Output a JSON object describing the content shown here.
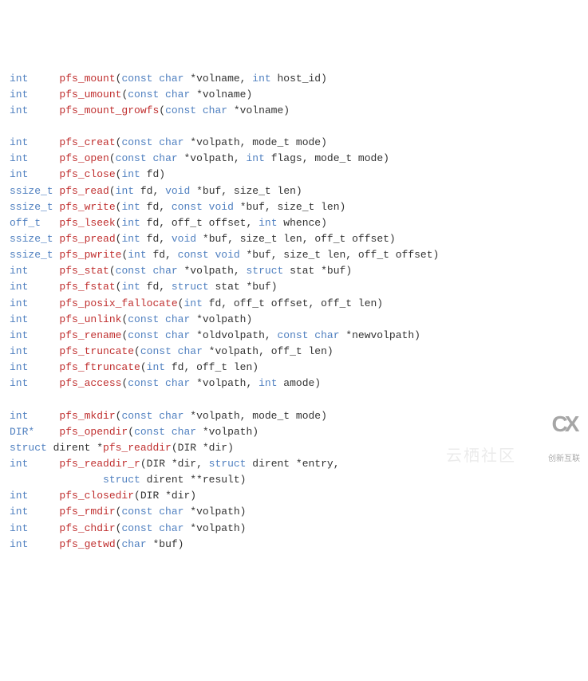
{
  "lines": [
    {
      "ret": "int    ",
      "fn": "pfs_mount",
      "params": [
        [
          "kw",
          "const char"
        ],
        [
          "p",
          " *volname, "
        ],
        [
          "kw",
          "int"
        ],
        [
          "p",
          " host_id)"
        ]
      ]
    },
    {
      "ret": "int    ",
      "fn": "pfs_umount",
      "params": [
        [
          "kw",
          "const char"
        ],
        [
          "p",
          " *volname)"
        ]
      ]
    },
    {
      "ret": "int    ",
      "fn": "pfs_mount_growfs",
      "params": [
        [
          "kw",
          "const char"
        ],
        [
          "p",
          " *volname)"
        ]
      ]
    },
    {
      "blank": true
    },
    {
      "ret": "int    ",
      "fn": "pfs_creat",
      "params": [
        [
          "kw",
          "const char"
        ],
        [
          "p",
          " *volpath, mode_t mode)"
        ]
      ]
    },
    {
      "ret": "int    ",
      "fn": "pfs_open",
      "params": [
        [
          "kw",
          "const char"
        ],
        [
          "p",
          " *volpath, "
        ],
        [
          "kw",
          "int"
        ],
        [
          "p",
          " flags, mode_t mode)"
        ]
      ]
    },
    {
      "ret": "int    ",
      "fn": "pfs_close",
      "params": [
        [
          "kw",
          "int"
        ],
        [
          "p",
          " fd)"
        ]
      ]
    },
    {
      "ret": "ssize_t",
      "fn": "pfs_read",
      "params": [
        [
          "kw",
          "int"
        ],
        [
          "p",
          " fd, "
        ],
        [
          "kw",
          "void"
        ],
        [
          "p",
          " *buf, size_t len)"
        ]
      ]
    },
    {
      "ret": "ssize_t",
      "fn": "pfs_write",
      "params": [
        [
          "kw",
          "int"
        ],
        [
          "p",
          " fd, "
        ],
        [
          "kw",
          "const void"
        ],
        [
          "p",
          " *buf, size_t len)"
        ]
      ]
    },
    {
      "ret": "off_t  ",
      "fn": "pfs_lseek",
      "params": [
        [
          "kw",
          "int"
        ],
        [
          "p",
          " fd, off_t offset, "
        ],
        [
          "kw",
          "int"
        ],
        [
          "p",
          " whence)"
        ]
      ]
    },
    {
      "ret": "ssize_t",
      "fn": "pfs_pread",
      "params": [
        [
          "kw",
          "int"
        ],
        [
          "p",
          " fd, "
        ],
        [
          "kw",
          "void"
        ],
        [
          "p",
          " *buf, size_t len, off_t offset)"
        ]
      ]
    },
    {
      "ret": "ssize_t",
      "fn": "pfs_pwrite",
      "params": [
        [
          "kw",
          "int"
        ],
        [
          "p",
          " fd, "
        ],
        [
          "kw",
          "const void"
        ],
        [
          "p",
          " *buf, size_t len, off_t offset)"
        ]
      ]
    },
    {
      "ret": "int    ",
      "fn": "pfs_stat",
      "params": [
        [
          "kw",
          "const char"
        ],
        [
          "p",
          " *volpath, "
        ],
        [
          "kw",
          "struct"
        ],
        [
          "p",
          " stat *buf)"
        ]
      ]
    },
    {
      "ret": "int    ",
      "fn": "pfs_fstat",
      "params": [
        [
          "kw",
          "int"
        ],
        [
          "p",
          " fd, "
        ],
        [
          "kw",
          "struct"
        ],
        [
          "p",
          " stat *buf)"
        ]
      ]
    },
    {
      "ret": "int    ",
      "fn": "pfs_posix_fallocate",
      "params": [
        [
          "kw",
          "int"
        ],
        [
          "p",
          " fd, off_t offset, off_t len)"
        ]
      ]
    },
    {
      "ret": "int    ",
      "fn": "pfs_unlink",
      "params": [
        [
          "kw",
          "const char"
        ],
        [
          "p",
          " *volpath)"
        ]
      ]
    },
    {
      "ret": "int    ",
      "fn": "pfs_rename",
      "params": [
        [
          "kw",
          "const char"
        ],
        [
          "p",
          " *oldvolpath, "
        ],
        [
          "kw",
          "const char"
        ],
        [
          "p",
          " *newvolpath)"
        ]
      ]
    },
    {
      "ret": "int    ",
      "fn": "pfs_truncate",
      "params": [
        [
          "kw",
          "const char"
        ],
        [
          "p",
          " *volpath, off_t len)"
        ]
      ]
    },
    {
      "ret": "int    ",
      "fn": "pfs_ftruncate",
      "params": [
        [
          "kw",
          "int"
        ],
        [
          "p",
          " fd, off_t len)"
        ]
      ]
    },
    {
      "ret": "int    ",
      "fn": "pfs_access",
      "params": [
        [
          "kw",
          "const char"
        ],
        [
          "p",
          " *volpath, "
        ],
        [
          "kw",
          "int"
        ],
        [
          "p",
          " amode)"
        ]
      ]
    },
    {
      "blank": true
    },
    {
      "ret": "int    ",
      "fn": "pfs_mkdir",
      "params": [
        [
          "kw",
          "const char"
        ],
        [
          "p",
          " *volpath, mode_t mode)"
        ]
      ]
    },
    {
      "ret": "DIR*   ",
      "fn": "pfs_opendir",
      "params": [
        [
          "kw",
          "const char"
        ],
        [
          "p",
          " *volpath)"
        ]
      ]
    },
    {
      "ret_kw": "struct",
      "ret_plain": " dirent *",
      "fn": "pfs_readdir",
      "params": [
        [
          "p",
          "DIR *dir)"
        ]
      ]
    },
    {
      "ret": "int    ",
      "fn": "pfs_readdir_r",
      "params": [
        [
          "p",
          "DIR *dir, "
        ],
        [
          "kw",
          "struct"
        ],
        [
          "p",
          " dirent *entry,"
        ]
      ]
    },
    {
      "cont": "               ",
      "params": [
        [
          "kw",
          "struct"
        ],
        [
          "p",
          " dirent **result)"
        ]
      ]
    },
    {
      "ret": "int    ",
      "fn": "pfs_closedir",
      "params": [
        [
          "p",
          "DIR *dir)"
        ]
      ]
    },
    {
      "ret": "int    ",
      "fn": "pfs_rmdir",
      "params": [
        [
          "kw",
          "const char"
        ],
        [
          "p",
          " *volpath)"
        ]
      ]
    },
    {
      "ret": "int    ",
      "fn": "pfs_chdir",
      "params": [
        [
          "kw",
          "const char"
        ],
        [
          "p",
          " *volpath)"
        ]
      ]
    },
    {
      "ret": "int    ",
      "fn": "pfs_getwd",
      "params": [
        [
          "kw",
          "char"
        ],
        [
          "p",
          " *buf)"
        ]
      ]
    }
  ],
  "watermark": {
    "text": "云栖社区",
    "logo_big": "CX",
    "logo_small": "创新互联"
  }
}
